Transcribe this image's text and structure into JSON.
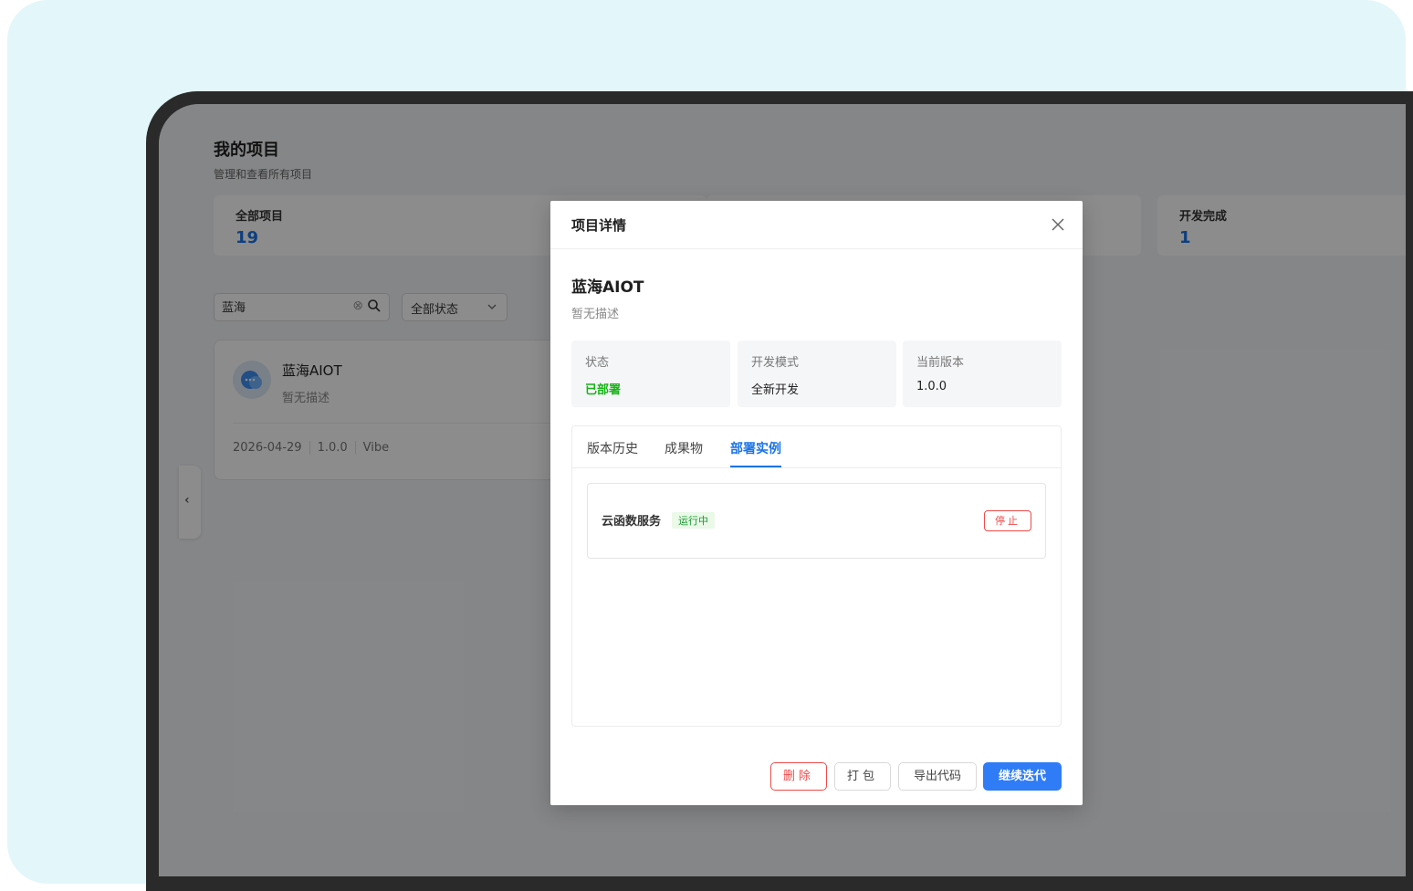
{
  "page": {
    "title": "我的项目",
    "subtitle": "管理和查看所有项目"
  },
  "stats": [
    {
      "label": "全部项目",
      "value": "19"
    },
    {
      "label": "开发完成",
      "value": "1"
    }
  ],
  "filters": {
    "search_value": "蓝海",
    "status_select": "全部状态"
  },
  "project_card": {
    "name": "蓝海AIOT",
    "description": "暂无描述",
    "date": "2026-04-29",
    "version": "1.0.0",
    "mode": "Vibe"
  },
  "modal": {
    "title": "项目详情",
    "project_name": "蓝海AIOT",
    "project_desc": "暂无描述",
    "info": [
      {
        "label": "状态",
        "value": "已部署"
      },
      {
        "label": "开发模式",
        "value": "全新开发"
      },
      {
        "label": "当前版本",
        "value": "1.0.0"
      }
    ],
    "tabs": [
      "版本历史",
      "成果物",
      "部署实例"
    ],
    "active_tab": "部署实例",
    "instance": {
      "name": "云函数服务",
      "status": "运行中",
      "stop_label": "停止"
    },
    "buttons": {
      "delete": "删除",
      "pack": "打包",
      "export": "导出代码",
      "continue": "继续迭代"
    }
  },
  "colors": {
    "accent": "#1a73e8",
    "danger": "#ef4a4a",
    "success": "#16b316",
    "primary_button": "#2f7cf6"
  }
}
